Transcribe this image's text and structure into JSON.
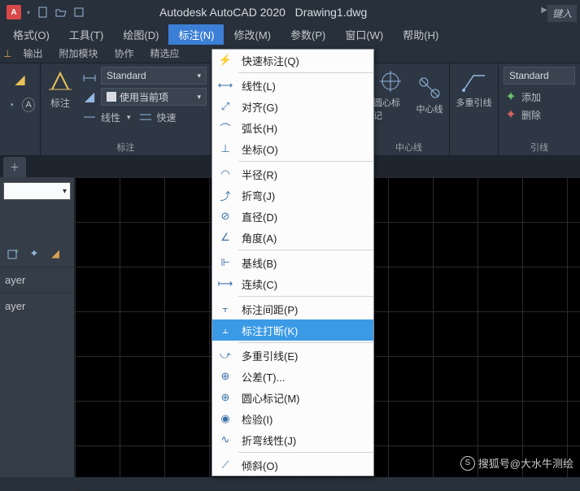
{
  "title": {
    "app": "Autodesk AutoCAD 2020",
    "doc": "Drawing1.dwg",
    "keybd": "键入"
  },
  "menubar": [
    "格式(O)",
    "工具(T)",
    "绘图(D)",
    "标注(N)",
    "修改(M)",
    "参数(P)",
    "窗口(W)",
    "帮助(H)"
  ],
  "menubar_active": 3,
  "tabs": [
    "输出",
    "附加模块",
    "协作",
    "精选应"
  ],
  "ribbon": {
    "dim_label": "标注",
    "std1": "Standard",
    "use_current": "使用当前项",
    "linear": "线性",
    "quick": "快速",
    "center_mark": "圆心标记",
    "centerline": "中心线",
    "center_panel": "中心线",
    "mleader": "多重引线",
    "std2": "Standard",
    "add": "添加",
    "delete": "删除",
    "leader_panel": "引线"
  },
  "dropdown": {
    "active_index": 13,
    "items": [
      {
        "label": "快速标注(Q)",
        "sep_after": true
      },
      {
        "label": "线性(L)"
      },
      {
        "label": "对齐(G)"
      },
      {
        "label": "弧长(H)"
      },
      {
        "label": "坐标(O)",
        "sep_after": true
      },
      {
        "label": "半径(R)"
      },
      {
        "label": "折弯(J)"
      },
      {
        "label": "直径(D)"
      },
      {
        "label": "角度(A)",
        "sep_after": true
      },
      {
        "label": "基线(B)"
      },
      {
        "label": "连续(C)",
        "sep_after": true
      },
      {
        "label": "标注间距(P)"
      },
      {
        "label": "标注打断(K)",
        "sep_after": true
      },
      {
        "label": "多重引线(E)"
      },
      {
        "label": "公差(T)..."
      },
      {
        "label": "圆心标记(M)"
      },
      {
        "label": "检验(I)"
      },
      {
        "label": "折弯线性(J)",
        "sep_after": true
      },
      {
        "label": "倾斜(O)"
      }
    ]
  },
  "sidebar": {
    "items": [
      "ayer",
      "ayer"
    ]
  },
  "watermark": "搜狐号@大水牛测绘"
}
